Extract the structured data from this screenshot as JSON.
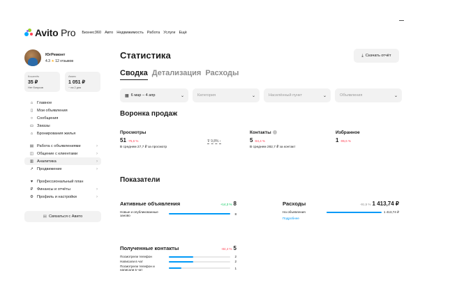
{
  "brand": {
    "name": "Avito",
    "suffix": " Pro"
  },
  "topnav": [
    "Бизнес360",
    "Авто",
    "Недвижимость",
    "Работа",
    "Услуги",
    "Ещё"
  ],
  "profile": {
    "name": "ЮгРемонт",
    "rating": "4.3",
    "reviews": "12 отзывов"
  },
  "wallets": [
    {
      "label": "Кошелёк",
      "value": "35 ₽",
      "sub": "Нет бонусов"
    },
    {
      "label": "Аванс",
      "value": "1 051 ₽",
      "sub": "~ на 2 дня"
    }
  ],
  "menu": [
    {
      "label": "Главное",
      "icon": "home-icon",
      "glyph": "⌂",
      "chevron": false
    },
    {
      "label": "Мои объявления",
      "icon": "listing-icon",
      "glyph": "▯",
      "chevron": false
    },
    {
      "label": "Сообщения",
      "icon": "message-icon",
      "glyph": "○",
      "chevron": false
    },
    {
      "label": "Заказы",
      "icon": "orders-icon",
      "glyph": "▭",
      "chevron": false
    },
    {
      "label": "Бронирования жилья",
      "icon": "booking-icon",
      "glyph": "⌂",
      "chevron": false
    },
    {
      "label": "Работа с объявлениями",
      "icon": "work-icon",
      "glyph": "▤",
      "chevron": true
    },
    {
      "label": "Общение с клиентами",
      "icon": "clients-icon",
      "glyph": "◫",
      "chevron": true
    },
    {
      "label": "Аналитика",
      "icon": "analytics-icon",
      "glyph": "▥",
      "chevron": true,
      "active": true
    },
    {
      "label": "Продвижение",
      "icon": "promotion-icon",
      "glyph": "↗",
      "chevron": true
    },
    {
      "label": "Профессиональный план",
      "icon": "plan-icon",
      "glyph": "♥",
      "chevron": false
    },
    {
      "label": "Финансы и отчёты",
      "icon": "finance-icon",
      "glyph": "₽",
      "chevron": true
    },
    {
      "label": "Профиль и настройки",
      "icon": "settings-icon",
      "glyph": "⚙",
      "chevron": true
    }
  ],
  "support": "Связаться с Авито",
  "page": {
    "title": "Статистика",
    "download": "Скачать отчёт"
  },
  "tabs": [
    "Сводка",
    "Детализация",
    "Расходы"
  ],
  "filters": {
    "date": "6 мар – 4 апр",
    "category": "Категория",
    "locality": "Населённый пункт",
    "listings": "Объявления"
  },
  "funnel": {
    "title": "Воронка продаж",
    "conversion": "9,8%",
    "views": {
      "label": "Просмотры",
      "value": "51",
      "pct": "-75,6 %",
      "sub": "В среднем 27,7 ₽ за просмотр"
    },
    "contacts": {
      "label": "Контакты",
      "value": "5",
      "pct": "-84,4 %",
      "sub": "В среднем 282,7 ₽ за контакт"
    },
    "favorites": {
      "label": "Избранное",
      "value": "1",
      "pct": "-95,6 %"
    }
  },
  "metrics": {
    "title": "Показатели",
    "active": {
      "title": "Активные объявления",
      "pct": "+14,3 %",
      "value": "8",
      "rows": [
        {
          "label": "Новые и опубликованные заново",
          "value": "8",
          "fraction": 1.0
        }
      ]
    },
    "expenses": {
      "title": "Расходы",
      "pct": "-91,5 %",
      "value": "1 413,74 ₽",
      "rows": [
        {
          "label": "На объявления",
          "value": "1 413,74 ₽",
          "fraction": 1.0
        }
      ],
      "link": "Подробнее"
    },
    "contacts": {
      "title": "Полученные контакты",
      "pct": "-84,4 %",
      "value": "5",
      "rows": [
        {
          "label": "Посмотрели телефон",
          "value": "2",
          "fraction": 0.4
        },
        {
          "label": "Написали в чат",
          "value": "2",
          "fraction": 0.4
        },
        {
          "label": "Посмотрели телефон и написали в чат",
          "value": "1",
          "fraction": 0.2
        }
      ]
    }
  },
  "colors": {
    "accent": "#0099f7",
    "positive": "#04c95c",
    "negative": "#ff4053",
    "star": "#ffb021"
  }
}
